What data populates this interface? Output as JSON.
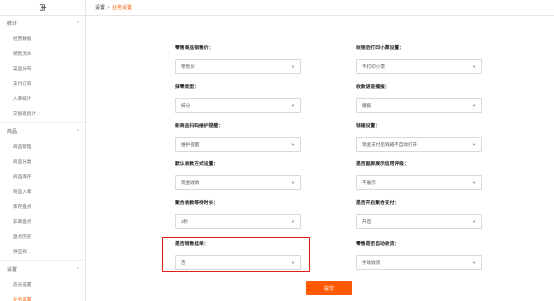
{
  "sidebar": {
    "collapse_icon": "collapse-icon",
    "sections": [
      {
        "title": "统计",
        "items": [
          "经营数据",
          "销售流水",
          "菜品分布",
          "支付订单",
          "入库统计",
          "交接班统计"
        ]
      },
      {
        "title": "商品",
        "items": [
          "商品管理",
          "商品分类",
          "商品库存",
          "商品入库",
          "库存盘点",
          "非库盘点",
          "盘点历史",
          "供应商"
        ]
      },
      {
        "title": "设置",
        "items": [
          "店员设置",
          "业务设置"
        ]
      }
    ],
    "active_item": "业务设置"
  },
  "breadcrumb": {
    "parent": "设置",
    "separator": ">",
    "current": "业务设置"
  },
  "form": {
    "left": [
      {
        "label": "零售商品销售价：",
        "value": "零售价"
      },
      {
        "label": "抹零类型：",
        "value": "抹分"
      },
      {
        "label": "新商品扫码维护提醒：",
        "value": "维护提醒"
      },
      {
        "label": "默认收款方式设置：",
        "value": "现金收款"
      },
      {
        "label": "聚合收款等待时长：",
        "value": "3秒"
      },
      {
        "label": "是否销售挂单：",
        "value": "否"
      }
    ],
    "right": [
      {
        "label": "收银后打印小票设置：",
        "value": "不打印小票"
      },
      {
        "label": "收款语音播报：",
        "value": "播报"
      },
      {
        "label": "钱箱设置：",
        "value": "现金支付后钱箱不自动打开"
      },
      {
        "label": "是否副屏展示信用评级：",
        "value": "不展示"
      },
      {
        "label": "是否开启聚合支付：",
        "value": "开启"
      },
      {
        "label": "零售是否自动收货：",
        "value": "手动收货"
      }
    ],
    "submit_label": "提交"
  },
  "colors": {
    "accent": "#ff5a00",
    "highlight_border": "#e0201a"
  }
}
